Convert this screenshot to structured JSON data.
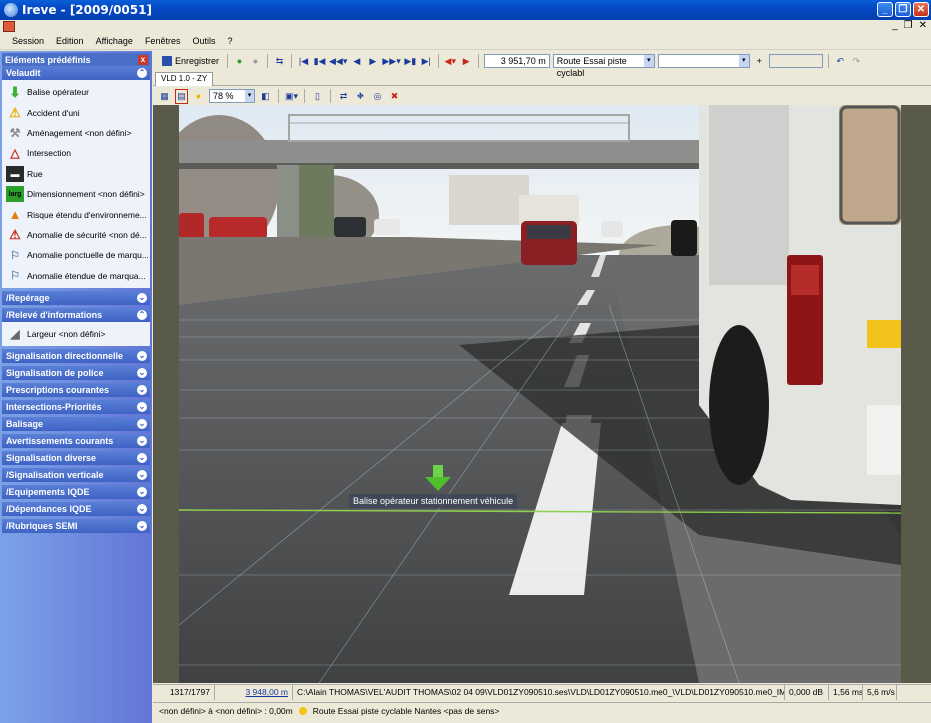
{
  "window": {
    "title": "Ireve - [2009/0051]"
  },
  "menu": [
    "Session",
    "Edition",
    "Affichage",
    "Fenêtres",
    "Outils",
    "?"
  ],
  "left_panel": {
    "header": "Eléments prédéfinis",
    "sections": [
      {
        "name": "Velaudit",
        "expanded": true,
        "items": [
          {
            "label": "Balise opérateur",
            "icon": "green-arrow-icon"
          },
          {
            "label": "Accident d'uni",
            "icon": "warning-icon"
          },
          {
            "label": "Aménagement <non défini>",
            "icon": "wrench-icon"
          },
          {
            "label": "Intersection",
            "icon": "intersection-icon"
          },
          {
            "label": "Rue",
            "icon": "road-icon"
          },
          {
            "label": "Dimensionnement <non défini>",
            "icon": "larg-icon"
          },
          {
            "label": "Risque étendu d'environneme...",
            "icon": "cone-icon"
          },
          {
            "label": "Anomalie de sécurité <non dé...",
            "icon": "warning-red-icon"
          },
          {
            "label": "Anomalie ponctuelle de marqu...",
            "icon": "marking-icon"
          },
          {
            "label": "Anomalie étendue de marqua...",
            "icon": "marking-icon"
          }
        ]
      },
      {
        "name": "/Repérage",
        "expanded": false,
        "items": []
      },
      {
        "name": "/Relevé d'informations",
        "expanded": true,
        "items": [
          {
            "label": "Largeur <non défini>",
            "icon": "ruler-icon"
          }
        ]
      },
      {
        "name": "Signalisation directionnelle",
        "expanded": false,
        "items": []
      },
      {
        "name": "Signalisation de police",
        "expanded": false,
        "items": []
      },
      {
        "name": "Prescriptions courantes",
        "expanded": false,
        "items": []
      },
      {
        "name": "Intersections-Priorités",
        "expanded": false,
        "items": []
      },
      {
        "name": "Balisage",
        "expanded": false,
        "items": []
      },
      {
        "name": "Avertissements courants",
        "expanded": false,
        "items": []
      },
      {
        "name": "Signalisation diverse",
        "expanded": false,
        "items": []
      },
      {
        "name": "/Signalisation verticale",
        "expanded": false,
        "items": []
      },
      {
        "name": "/Equipements IQDE",
        "expanded": false,
        "items": []
      },
      {
        "name": "/Dépendances IQDE",
        "expanded": false,
        "items": []
      },
      {
        "name": "/Rubriques SEMI",
        "expanded": false,
        "items": []
      }
    ]
  },
  "toolbar": {
    "save_label": "Enregistrer",
    "distance": "3 951,70 m",
    "route": "Route Essai piste cyclabl",
    "zoom": "78 %"
  },
  "tab": "VLD 1.0 - ZY",
  "viewer": {
    "annotation": "Balise opérateur stationnement véhicule"
  },
  "status": {
    "frame": "1317/1797",
    "distance": "3 948,00 m",
    "path": "C:\\Alain THOMAS\\VEL'AUDIT THOMAS\\02 04 09\\VLD01ZY090510.ses\\VLD\\LD01ZY090510.me0_\\VLD\\LD01ZY090510.me0_IMAGES.1.001316",
    "db": "0,000 dB",
    "ms": "1,56 ms",
    "speed": "5,6 m/s",
    "range": "<non défini> à <non défini> : 0,00m",
    "route_full": "Route Essai piste cyclable Nantes <pas de sens>"
  }
}
